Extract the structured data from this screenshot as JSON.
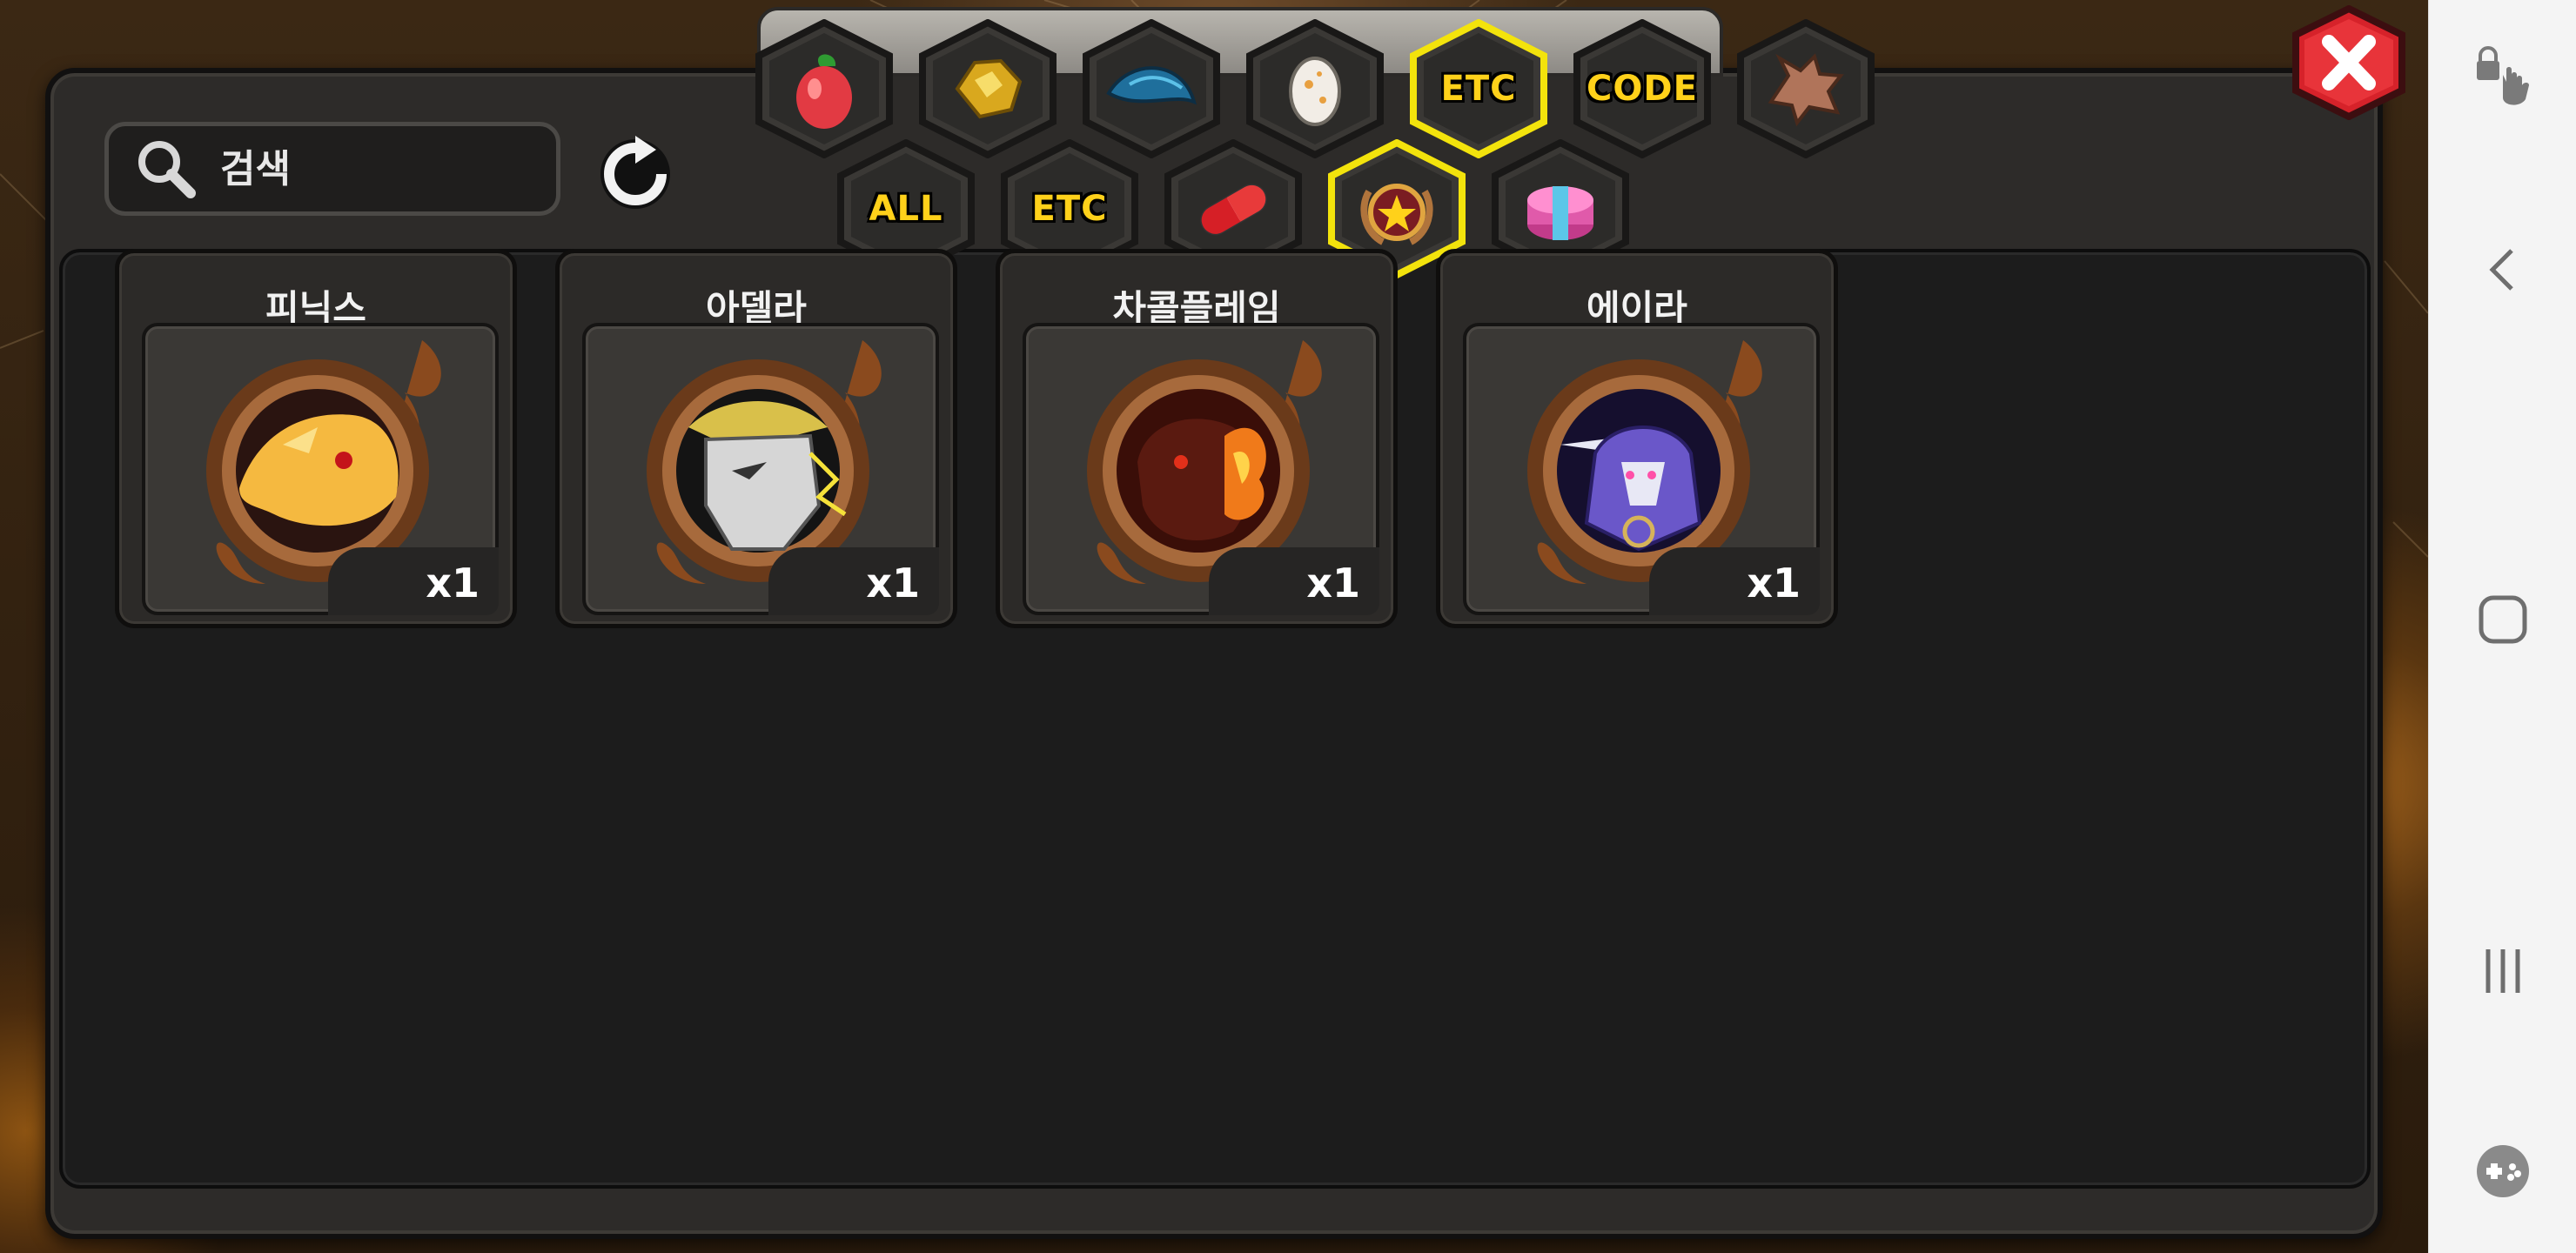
{
  "search": {
    "placeholder": "검색"
  },
  "tabs_row1": [
    {
      "name": "fruit-tab",
      "label": "",
      "icon": "fruit-icon"
    },
    {
      "name": "gold-tab",
      "label": "",
      "icon": "gold-nugget-icon"
    },
    {
      "name": "scale-tab",
      "label": "",
      "icon": "blue-scale-icon"
    },
    {
      "name": "egg-tab",
      "label": "",
      "icon": "egg-icon"
    },
    {
      "name": "etc-tab-top",
      "label": "ETC",
      "icon": "",
      "selected": true
    },
    {
      "name": "code-tab",
      "label": "CODE",
      "icon": ""
    },
    {
      "name": "dragon-tab",
      "label": "",
      "icon": "dragon-head-icon"
    }
  ],
  "tabs_row2": [
    {
      "name": "all-tab",
      "label": "ALL",
      "icon": ""
    },
    {
      "name": "etc-tab",
      "label": "ETC",
      "icon": ""
    },
    {
      "name": "capsule-tab",
      "label": "",
      "icon": "capsule-icon"
    },
    {
      "name": "badge-tab",
      "label": "",
      "icon": "star-badge-icon",
      "selected": true
    },
    {
      "name": "giftbox-tab",
      "label": "",
      "icon": "gift-box-icon"
    }
  ],
  "items": [
    {
      "name": "피닉스",
      "qty": "x1",
      "portrait": "phoenix-portrait",
      "accent": "#f5b940"
    },
    {
      "name": "아델라",
      "qty": "x1",
      "portrait": "adela-portrait",
      "accent": "#d6d6d6"
    },
    {
      "name": "차콜플레임",
      "qty": "x1",
      "portrait": "charcoal-flame-portrait",
      "accent": "#d6451d"
    },
    {
      "name": "에이라",
      "qty": "x1",
      "portrait": "eira-portrait",
      "accent": "#6a57c9"
    }
  ],
  "colors": {
    "accent_yellow": "#ffd11a",
    "selected_border": "#f3e30c",
    "close_red": "#d6222a"
  }
}
